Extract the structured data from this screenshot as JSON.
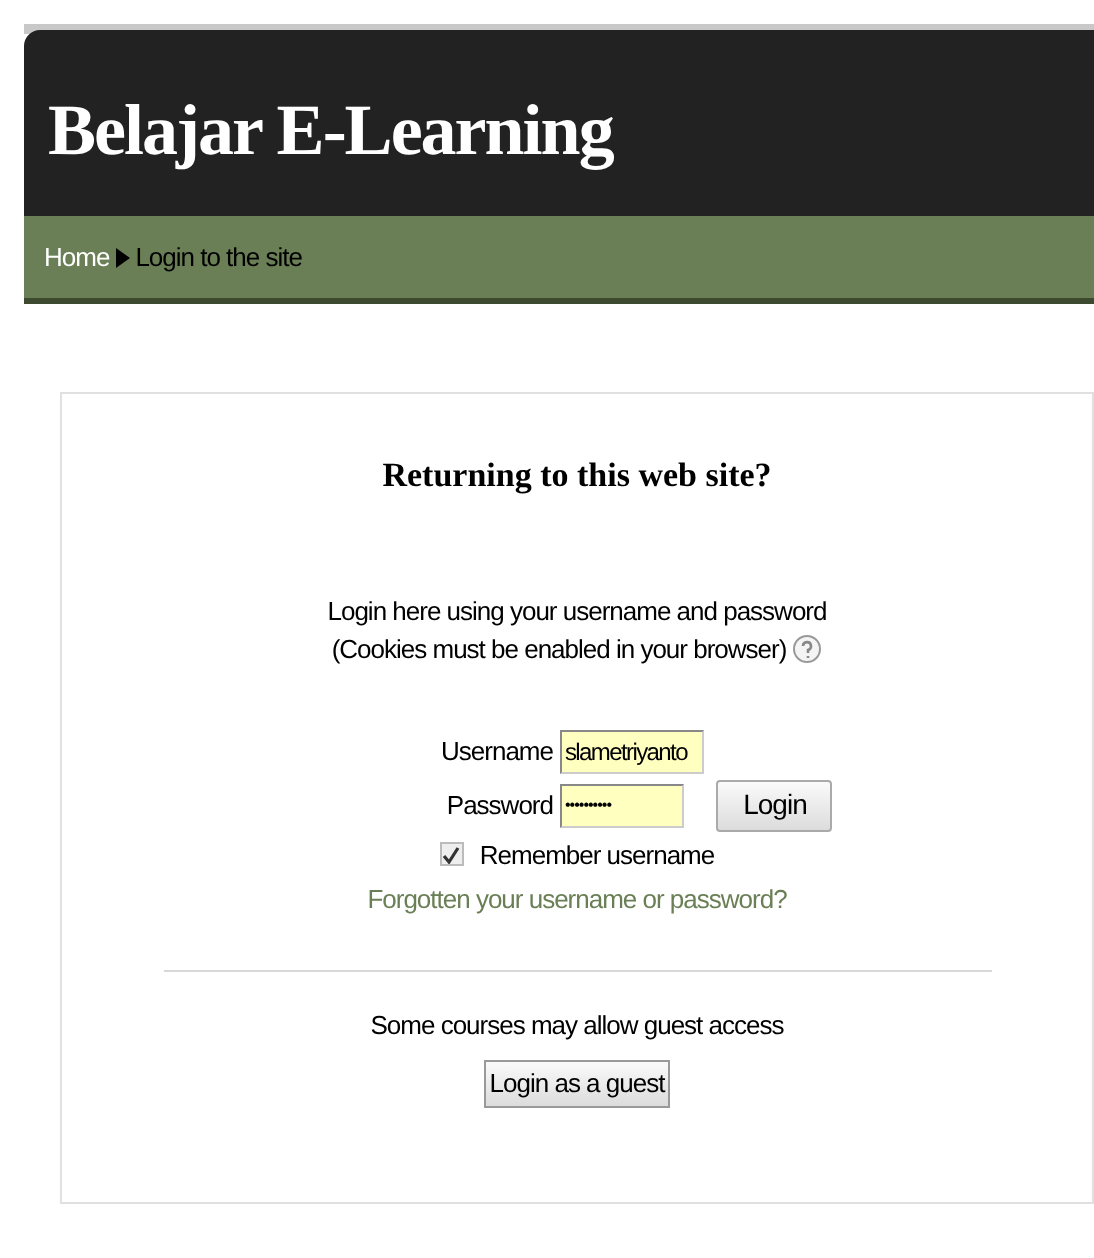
{
  "header": {
    "site_title": "Belajar E-Learning"
  },
  "breadcrumb": [
    {
      "label": "Home",
      "kind": "link"
    },
    {
      "label": "Login to the site",
      "kind": "current"
    }
  ],
  "login": {
    "heading": "Returning to this web site?",
    "intro": "Login here using your username and password",
    "cookies_note": "(Cookies must be enabled in your browser)",
    "username_label": "Username",
    "username_value": "slametriyanto",
    "password_label": "Password",
    "password_value": "••••••••••",
    "login_button": "Login",
    "remember": {
      "label": "Remember username",
      "checked": true
    },
    "forgot_link": "Forgotten your username or password?",
    "guest_note": "Some courses may allow guest access",
    "guest_button": "Login as a guest"
  }
}
